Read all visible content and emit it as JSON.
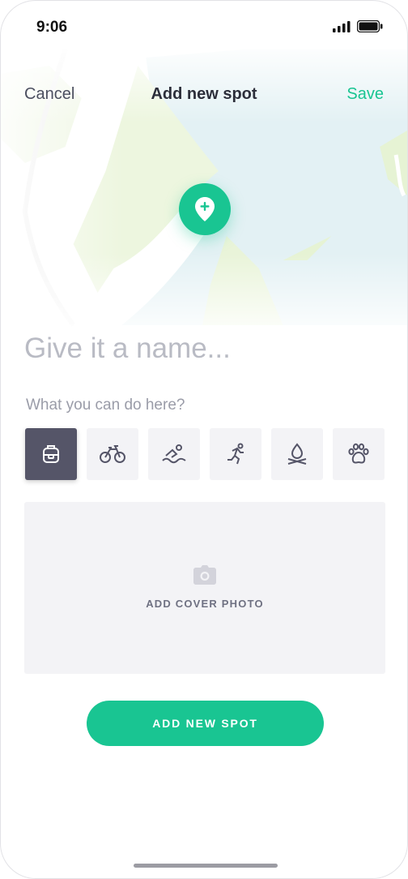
{
  "status_bar": {
    "time": "9:06",
    "icons": [
      "signal-icon",
      "battery-icon"
    ]
  },
  "nav": {
    "cancel_label": "Cancel",
    "title": "Add new spot",
    "save_label": "Save"
  },
  "map": {
    "pin_icon": "map-pin-plus-icon"
  },
  "form": {
    "name_placeholder": "Give it a name...",
    "name_value": "",
    "activities_label": "What you can do here?",
    "activities": [
      {
        "icon": "backpack-icon",
        "selected": true
      },
      {
        "icon": "bicycle-icon",
        "selected": false
      },
      {
        "icon": "swimming-icon",
        "selected": false
      },
      {
        "icon": "running-icon",
        "selected": false
      },
      {
        "icon": "campfire-icon",
        "selected": false
      },
      {
        "icon": "paw-icon",
        "selected": false
      }
    ],
    "cover_photo_label": "ADD COVER PHOTO",
    "cover_photo_icon": "camera-icon"
  },
  "cta": {
    "label": "ADD NEW SPOT"
  },
  "colors": {
    "accent": "#19c592",
    "selected_tile": "#555568",
    "tile_bg": "#f3f3f6",
    "text_dark": "#2c2e3a",
    "text_muted": "#9a9ca8"
  }
}
